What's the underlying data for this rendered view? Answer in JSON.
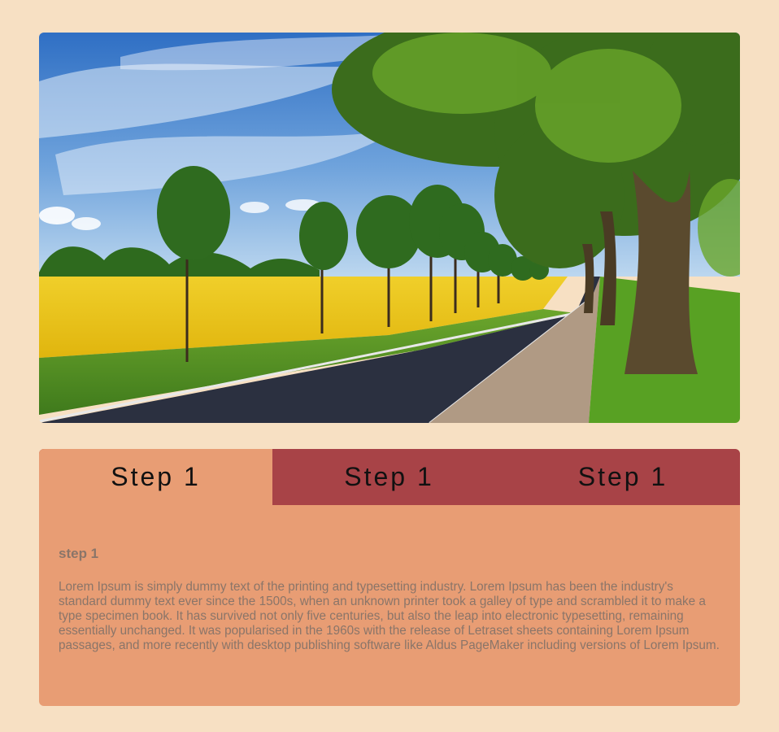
{
  "hero": {
    "image_name": "countryside-road-with-trees-photo"
  },
  "tabs": [
    {
      "label": "Step 1",
      "active": true
    },
    {
      "label": "Step 1",
      "active": false
    },
    {
      "label": "Step 1",
      "active": false
    }
  ],
  "content": {
    "heading": "step 1",
    "body": "Lorem Ipsum is simply dummy text of the printing and typesetting industry. Lorem Ipsum has been the industry's standard dummy text ever since the 1500s, when an unknown printer took a galley of type and scrambled it to make a type specimen book. It has survived not only five centuries, but also the leap into electronic typesetting, remaining essentially unchanged. It was popularised in the 1960s with the release of Letraset sheets containing Lorem Ipsum passages, and more recently with desktop publishing software like Aldus PageMaker including versions of Lorem Ipsum."
  },
  "colors": {
    "page_background": "#f7e0c3",
    "tab_inactive": "#a84347",
    "tab_active_and_panel": "#e89d74",
    "content_text": "#8a7569"
  }
}
